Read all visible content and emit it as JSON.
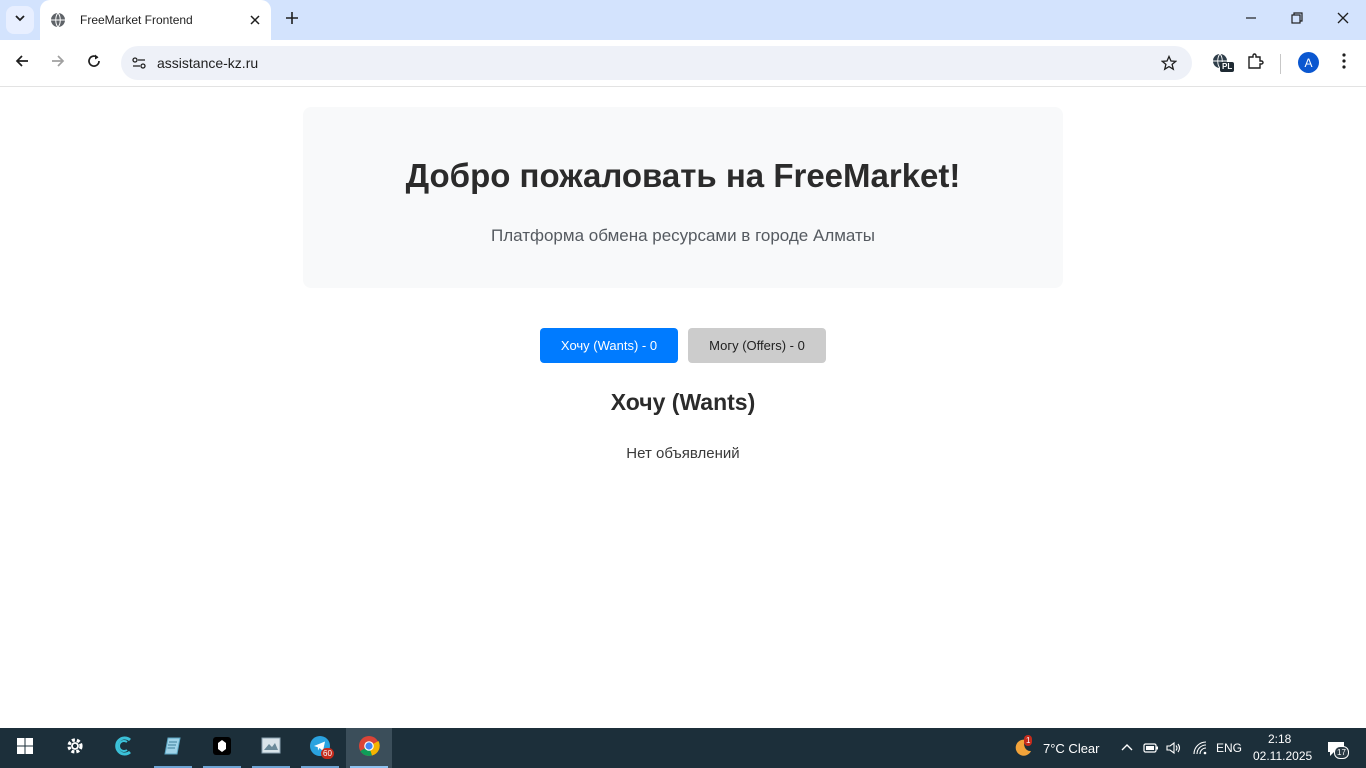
{
  "browser": {
    "tab_title": "FreeMarket Frontend",
    "url": "assistance-kz.ru",
    "profile_initial": "A",
    "extension_badge": "PL"
  },
  "page": {
    "hero_title": "Добро пожаловать на FreeMarket!",
    "hero_subtitle": "Платформа обмена ресурсами в городе Алматы",
    "tabs": [
      {
        "label": "Хочу (Wants) - 0",
        "active": true
      },
      {
        "label": "Могу (Offers) - 0",
        "active": false
      }
    ],
    "section_title": "Хочу (Wants)",
    "empty_text": "Нет объявлений",
    "colors": {
      "accent": "#007bff",
      "inactive_tab": "#cccccc",
      "hero_bg": "#f8f9fa"
    }
  },
  "taskbar": {
    "apps": [
      "start-icon",
      "settings-icon",
      "app-c-icon",
      "notepad-icon",
      "terminal-icon",
      "photos-icon",
      "telegram-icon",
      "chrome-icon"
    ],
    "telegram_badge": "60",
    "weather_badge": "1",
    "weather": "7°C  Clear",
    "language": "ENG",
    "time": "2:18",
    "date": "02.11.2025",
    "notifications": "17"
  }
}
